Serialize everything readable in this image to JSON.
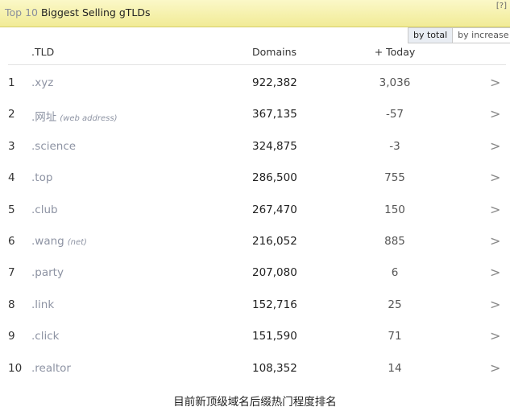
{
  "header": {
    "title_prefix": "Top 10",
    "title_main": "Biggest Selling gTLDs",
    "help": "[?]"
  },
  "toggle": {
    "by_total": "by total",
    "by_increase": "by increase"
  },
  "columns": {
    "tld": ".TLD",
    "domains": "Domains",
    "today": "+ Today"
  },
  "rows": [
    {
      "rank": "1",
      "tld": ".xyz",
      "note": "",
      "domains": "922,382",
      "today": "3,036"
    },
    {
      "rank": "2",
      "tld": ".网址",
      "note": "(web address)",
      "domains": "367,135",
      "today": "-57"
    },
    {
      "rank": "3",
      "tld": ".science",
      "note": "",
      "domains": "324,875",
      "today": "-3"
    },
    {
      "rank": "4",
      "tld": ".top",
      "note": "",
      "domains": "286,500",
      "today": "755"
    },
    {
      "rank": "5",
      "tld": ".club",
      "note": "",
      "domains": "267,470",
      "today": "150"
    },
    {
      "rank": "6",
      "tld": ".wang",
      "note": "(net)",
      "domains": "216,052",
      "today": "885"
    },
    {
      "rank": "7",
      "tld": ".party",
      "note": "",
      "domains": "207,080",
      "today": "6"
    },
    {
      "rank": "8",
      "tld": ".link",
      "note": "",
      "domains": "152,716",
      "today": "25"
    },
    {
      "rank": "9",
      "tld": ".click",
      "note": "",
      "domains": "151,590",
      "today": "71"
    },
    {
      "rank": "10",
      "tld": ".realtor",
      "note": "",
      "domains": "108,352",
      "today": "14"
    }
  ],
  "row_arrow": ">",
  "caption": "目前新顶级域名后缀热门程度排名"
}
